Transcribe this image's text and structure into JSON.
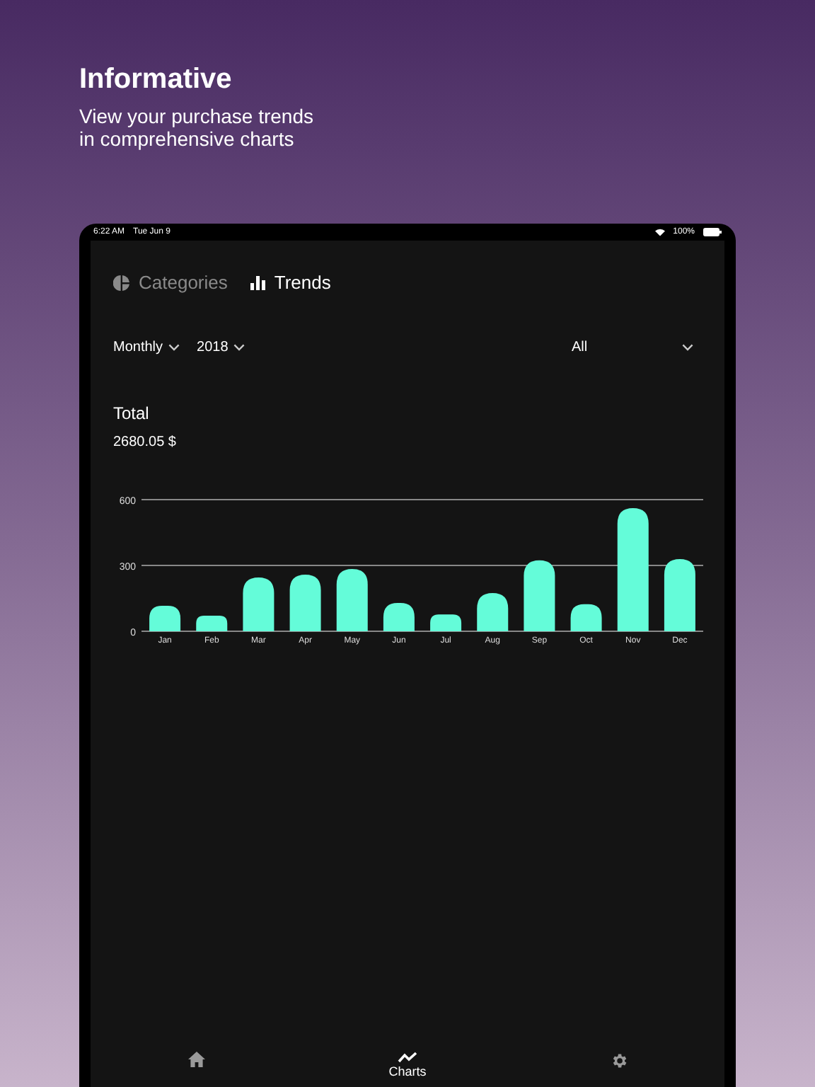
{
  "header": {
    "title": "Informative",
    "subtitle": "View your purchase trends\nin comprehensive charts"
  },
  "status_bar": {
    "time": "6:22 AM",
    "date": "Tue Jun 9",
    "battery": "100%"
  },
  "tabs": [
    {
      "label": "Categories",
      "selected": false
    },
    {
      "label": "Trends",
      "selected": true
    }
  ],
  "filters": [
    {
      "value": "Monthly"
    },
    {
      "value": "2018"
    },
    {
      "value": "All"
    }
  ],
  "total": {
    "label": "Total",
    "amount": "2680.05 $"
  },
  "chart_data": {
    "type": "bar",
    "categories": [
      "Jan",
      "Feb",
      "Mar",
      "Apr",
      "May",
      "Jun",
      "Jul",
      "Aug",
      "Sep",
      "Oct",
      "Nov",
      "Dec"
    ],
    "series": [
      {
        "color": "#64fcd9",
        "values": [
          116,
          71,
          245,
          258,
          284,
          129,
          77,
          174,
          323,
          123,
          561,
          329
        ]
      }
    ],
    "ylim": [
      0,
      600
    ],
    "yticks": [
      0,
      300,
      600
    ]
  },
  "bottom_nav": [
    {
      "selected": false
    },
    {
      "label": "Charts",
      "selected": true
    },
    {
      "selected": false
    }
  ]
}
